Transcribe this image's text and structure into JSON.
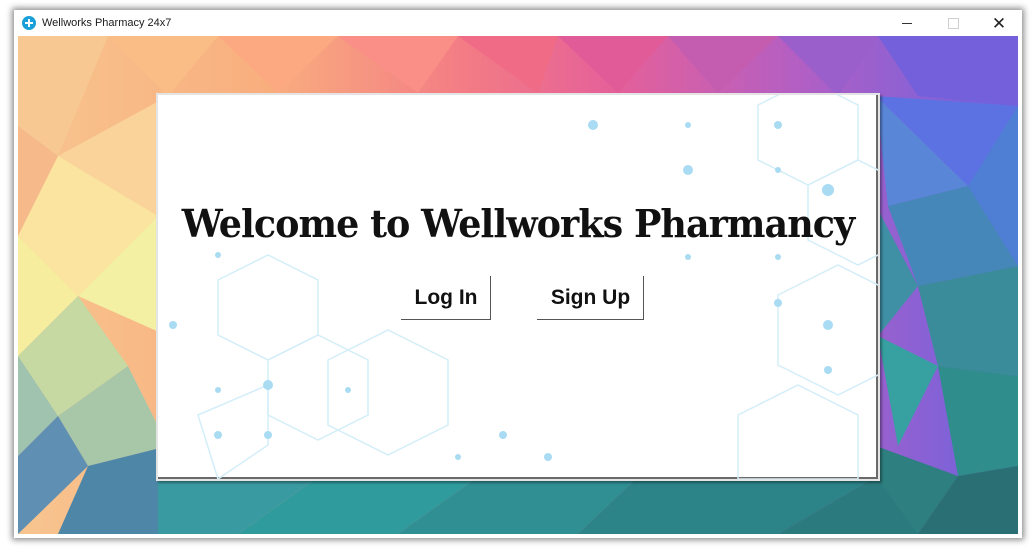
{
  "window": {
    "title": "Wellworks Pharmacy 24x7",
    "app_icon": "medical-cross-icon",
    "controls": {
      "minimize": "minimize-icon",
      "maximize": "maximize-icon",
      "close": "close-icon",
      "close_glyph": "✕"
    }
  },
  "main": {
    "heading": "Welcome to Wellworks Pharmancy",
    "buttons": {
      "login_label": "Log In",
      "signup_label": "Sign Up"
    }
  },
  "colors": {
    "panel_background": "#ffffff",
    "accent_dots": "#a9dbf3",
    "app_icon": "#1aa0d8"
  }
}
